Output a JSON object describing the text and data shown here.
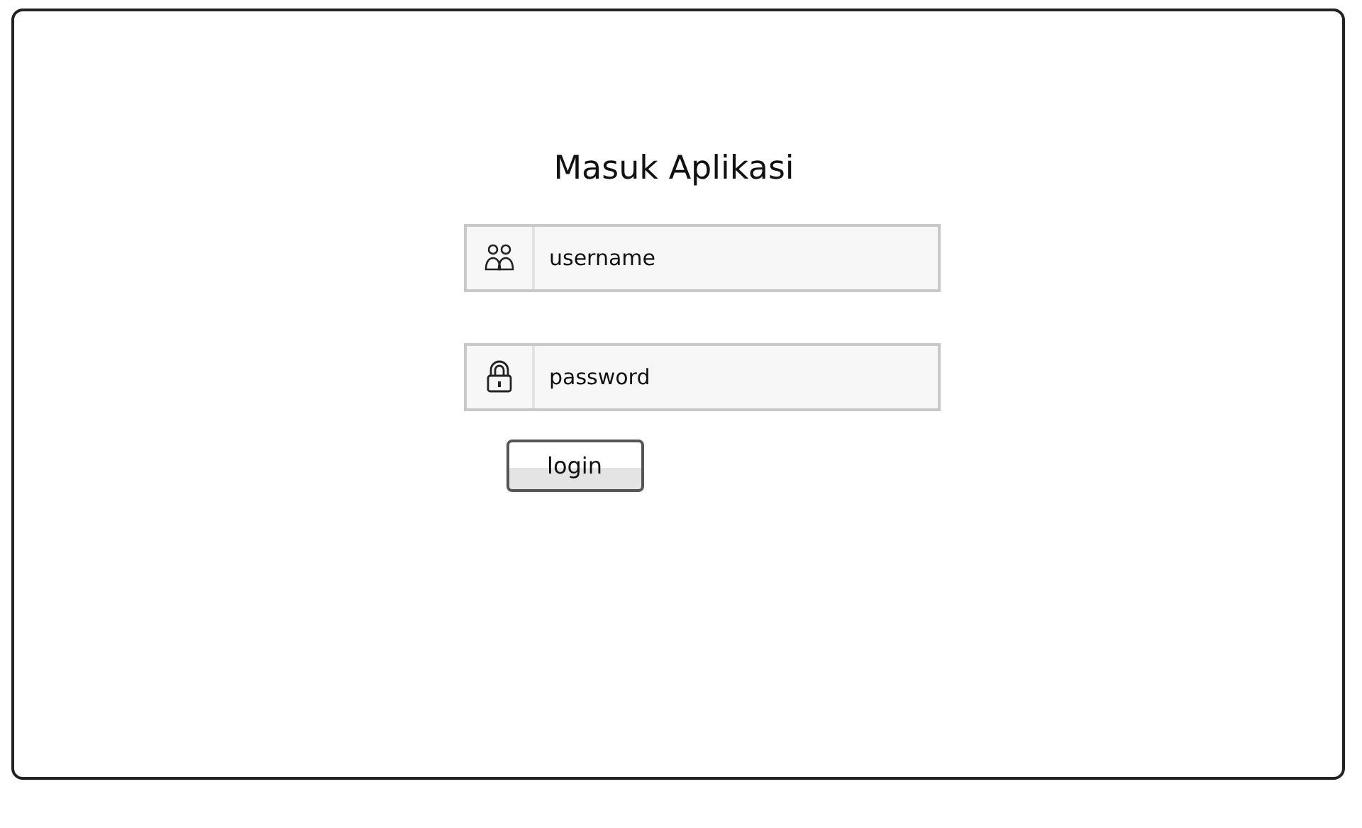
{
  "title": "Masuk Aplikasi",
  "fields": [
    {
      "kind": "user",
      "value": "username"
    },
    {
      "kind": "lock",
      "value": "password"
    }
  ],
  "button": "login"
}
